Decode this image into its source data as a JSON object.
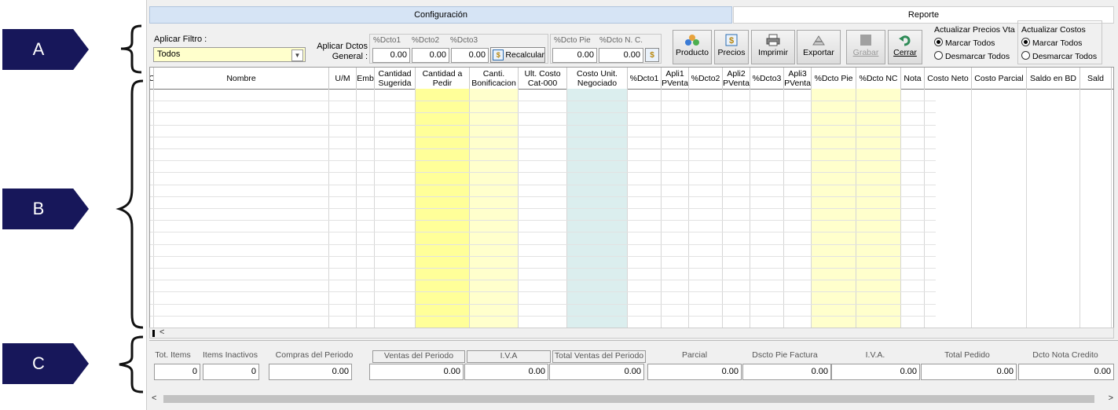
{
  "callouts": [
    "A",
    "B",
    "C"
  ],
  "tabs": {
    "config": "Configuración",
    "report": "Reporte"
  },
  "filter": {
    "label": "Aplicar Filtro :",
    "value": "Todos"
  },
  "dctos": {
    "label1": "Aplicar Dctos",
    "label2": "General :",
    "heads": [
      "%Dcto1",
      "%Dcto2",
      "%Dcto3",
      "%Dcto Pie",
      "%Dcto N. C."
    ],
    "values": [
      "0.00",
      "0.00",
      "0.00",
      "0.00",
      "0.00"
    ],
    "recalc": "Recalcular"
  },
  "toolbar": {
    "producto": "Producto",
    "precios": "Precios",
    "imprimir": "Imprimir",
    "exportar": "Exportar",
    "grabar": "Grabar",
    "cerrar": "Cerrar"
  },
  "precios_vta": {
    "title": "Actualizar Precios Vta",
    "mark": "Marcar Todos",
    "unmark": "Desmarcar Todos"
  },
  "costos": {
    "title": "Actualizar Costos",
    "mark": "Marcar Todos",
    "unmark": "Desmarcar Todos"
  },
  "grid": {
    "headers": [
      "C",
      "Nombre",
      "U/M",
      "Emb",
      "Cantidad Sugerida",
      "Cantidad a Pedir",
      "Canti. Bonificacion",
      "Ult. Costo Cat-000",
      "Costo Unit. Negociado",
      "%Dcto1",
      "Apli1 PVenta",
      "%Dcto2",
      "Apli2 PVenta",
      "%Dcto3",
      "Apli3 PVenta",
      "%Dcto Pie",
      "%Dcto NC",
      "Nota",
      "Costo Neto",
      "Costo Parcial",
      "Saldo en BD",
      "Sald"
    ]
  },
  "footer": {
    "labels": [
      "Tot. Items",
      "Items Inactivos",
      "Compras del Periodo",
      "Ventas del Periodo",
      "I.V.A",
      "Total Ventas del Periodo",
      "Parcial",
      "Dscto Pie Factura",
      "I.V.A.",
      "Total Pedido",
      "Dcto Nota Credito"
    ],
    "values": [
      "0",
      "0",
      "0.00",
      "0.00",
      "0.00",
      "0.00",
      "0.00",
      "0.00",
      "0.00",
      "0.00",
      "0.00"
    ]
  },
  "colors": {
    "callout": "#17175a",
    "yellow": "#ffff99",
    "lightyellow": "#ffffcc",
    "lightcyan": "#dbeeee",
    "tab": "#d6e4f5"
  }
}
